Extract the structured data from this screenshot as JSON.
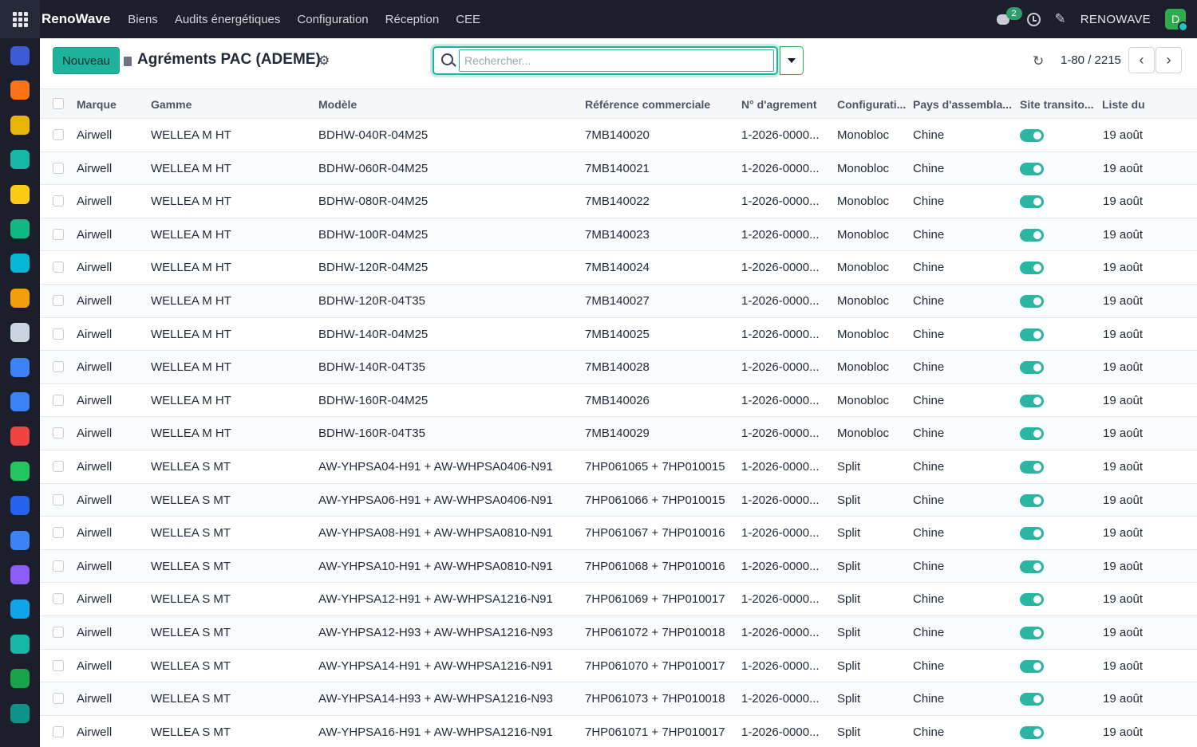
{
  "topbar": {
    "brand": "RenoWave",
    "menu": [
      "Biens",
      "Audits énergétiques",
      "Configuration",
      "Réception",
      "CEE"
    ],
    "chat_count": "2",
    "company": "RENOWAVE",
    "avatar_initial": "D"
  },
  "sidebar": {
    "icons": [
      {
        "name": "app-1-icon",
        "color": "#3b5bdb"
      },
      {
        "name": "app-2-icon",
        "color": "#f97316"
      },
      {
        "name": "calendar-31-icon",
        "color": "#eab308"
      },
      {
        "name": "sign-icon",
        "color": "#14b8a6"
      },
      {
        "name": "app-5-icon",
        "color": "#facc15"
      },
      {
        "name": "contacts-icon",
        "color": "#10b981"
      },
      {
        "name": "app-7-icon",
        "color": "#06b6d4"
      },
      {
        "name": "app-8-icon",
        "color": "#f59e0b"
      },
      {
        "name": "bank-icon",
        "color": "#cbd5e1"
      },
      {
        "name": "app-10-icon",
        "color": "#3b82f6"
      },
      {
        "name": "calendar-icon",
        "color": "#3b82f6"
      },
      {
        "name": "dashboard-icon",
        "color": "#ef4444"
      },
      {
        "name": "app-13-icon",
        "color": "#22c55e"
      },
      {
        "name": "calendar-2-icon",
        "color": "#2563eb"
      },
      {
        "name": "app-15-icon",
        "color": "#3b82f6"
      },
      {
        "name": "app-16-icon",
        "color": "#8b5cf6"
      },
      {
        "name": "app-17-icon",
        "color": "#0ea5e9"
      },
      {
        "name": "app-18-icon",
        "color": "#14b8a6"
      },
      {
        "name": "app-19-icon",
        "color": "#16a34a"
      },
      {
        "name": "app-20-icon",
        "color": "#0d9488"
      }
    ]
  },
  "control": {
    "new_button": "Nouveau",
    "title": "Agréments PAC (ADEME)",
    "search_placeholder": "Rechercher...",
    "pager": "1-80 / 2215"
  },
  "columns": [
    "Marque",
    "Gamme",
    "Modèle",
    "Référence commerciale",
    "N° d'agrement",
    "Configurati...",
    "Pays d'assembla...",
    "Site transito...",
    "Liste du"
  ],
  "rows": [
    {
      "marque": "Airwell",
      "gamme": "WELLEA M HT",
      "modele": "BDHW-040R-04M25",
      "ref": "7MB140020",
      "agrement": "1-2026-0000...",
      "config": "Monobloc",
      "pays": "Chine",
      "site": true,
      "liste": "19 août"
    },
    {
      "marque": "Airwell",
      "gamme": "WELLEA M HT",
      "modele": "BDHW-060R-04M25",
      "ref": "7MB140021",
      "agrement": "1-2026-0000...",
      "config": "Monobloc",
      "pays": "Chine",
      "site": true,
      "liste": "19 août"
    },
    {
      "marque": "Airwell",
      "gamme": "WELLEA M HT",
      "modele": "BDHW-080R-04M25",
      "ref": "7MB140022",
      "agrement": "1-2026-0000...",
      "config": "Monobloc",
      "pays": "Chine",
      "site": true,
      "liste": "19 août"
    },
    {
      "marque": "Airwell",
      "gamme": "WELLEA M HT",
      "modele": "BDHW-100R-04M25",
      "ref": "7MB140023",
      "agrement": "1-2026-0000...",
      "config": "Monobloc",
      "pays": "Chine",
      "site": true,
      "liste": "19 août"
    },
    {
      "marque": "Airwell",
      "gamme": "WELLEA M HT",
      "modele": "BDHW-120R-04M25",
      "ref": "7MB140024",
      "agrement": "1-2026-0000...",
      "config": "Monobloc",
      "pays": "Chine",
      "site": true,
      "liste": "19 août"
    },
    {
      "marque": "Airwell",
      "gamme": "WELLEA M HT",
      "modele": "BDHW-120R-04T35",
      "ref": "7MB140027",
      "agrement": "1-2026-0000...",
      "config": "Monobloc",
      "pays": "Chine",
      "site": true,
      "liste": "19 août"
    },
    {
      "marque": "Airwell",
      "gamme": "WELLEA M HT",
      "modele": "BDHW-140R-04M25",
      "ref": "7MB140025",
      "agrement": "1-2026-0000...",
      "config": "Monobloc",
      "pays": "Chine",
      "site": true,
      "liste": "19 août"
    },
    {
      "marque": "Airwell",
      "gamme": "WELLEA M HT",
      "modele": "BDHW-140R-04T35",
      "ref": "7MB140028",
      "agrement": "1-2026-0000...",
      "config": "Monobloc",
      "pays": "Chine",
      "site": true,
      "liste": "19 août"
    },
    {
      "marque": "Airwell",
      "gamme": "WELLEA M HT",
      "modele": "BDHW-160R-04M25",
      "ref": "7MB140026",
      "agrement": "1-2026-0000...",
      "config": "Monobloc",
      "pays": "Chine",
      "site": true,
      "liste": "19 août"
    },
    {
      "marque": "Airwell",
      "gamme": "WELLEA M HT",
      "modele": "BDHW-160R-04T35",
      "ref": "7MB140029",
      "agrement": "1-2026-0000...",
      "config": "Monobloc",
      "pays": "Chine",
      "site": true,
      "liste": "19 août"
    },
    {
      "marque": "Airwell",
      "gamme": "WELLEA S MT",
      "modele": "AW-YHPSA04-H91 + AW-WHPSA0406-N91",
      "ref": "7HP061065 + 7HP010015",
      "agrement": "1-2026-0000...",
      "config": "Split",
      "pays": "Chine",
      "site": true,
      "liste": "19 août"
    },
    {
      "marque": "Airwell",
      "gamme": "WELLEA S MT",
      "modele": "AW-YHPSA06-H91 + AW-WHPSA0406-N91",
      "ref": "7HP061066 + 7HP010015",
      "agrement": "1-2026-0000...",
      "config": "Split",
      "pays": "Chine",
      "site": true,
      "liste": "19 août"
    },
    {
      "marque": "Airwell",
      "gamme": "WELLEA S MT",
      "modele": "AW-YHPSA08-H91 + AW-WHPSA0810-N91",
      "ref": "7HP061067 + 7HP010016",
      "agrement": "1-2026-0000...",
      "config": "Split",
      "pays": "Chine",
      "site": true,
      "liste": "19 août"
    },
    {
      "marque": "Airwell",
      "gamme": "WELLEA S MT",
      "modele": "AW-YHPSA10-H91 + AW-WHPSA0810-N91",
      "ref": "7HP061068 + 7HP010016",
      "agrement": "1-2026-0000...",
      "config": "Split",
      "pays": "Chine",
      "site": true,
      "liste": "19 août"
    },
    {
      "marque": "Airwell",
      "gamme": "WELLEA S MT",
      "modele": "AW-YHPSA12-H91 + AW-WHPSA1216-N91",
      "ref": "7HP061069 + 7HP010017",
      "agrement": "1-2026-0000...",
      "config": "Split",
      "pays": "Chine",
      "site": true,
      "liste": "19 août"
    },
    {
      "marque": "Airwell",
      "gamme": "WELLEA S MT",
      "modele": "AW-YHPSA12-H93 + AW-WHPSA1216-N93",
      "ref": "7HP061072 + 7HP010018",
      "agrement": "1-2026-0000...",
      "config": "Split",
      "pays": "Chine",
      "site": true,
      "liste": "19 août"
    },
    {
      "marque": "Airwell",
      "gamme": "WELLEA S MT",
      "modele": "AW-YHPSA14-H91 + AW-WHPSA1216-N91",
      "ref": "7HP061070 + 7HP010017",
      "agrement": "1-2026-0000...",
      "config": "Split",
      "pays": "Chine",
      "site": true,
      "liste": "19 août"
    },
    {
      "marque": "Airwell",
      "gamme": "WELLEA S MT",
      "modele": "AW-YHPSA14-H93 + AW-WHPSA1216-N93",
      "ref": "7HP061073 + 7HP010018",
      "agrement": "1-2026-0000...",
      "config": "Split",
      "pays": "Chine",
      "site": true,
      "liste": "19 août"
    },
    {
      "marque": "Airwell",
      "gamme": "WELLEA S MT",
      "modele": "AW-YHPSA16-H91 + AW-WHPSA1216-N91",
      "ref": "7HP061071 + 7HP010017",
      "agrement": "1-2026-0000...",
      "config": "Split",
      "pays": "Chine",
      "site": true,
      "liste": "19 août"
    }
  ]
}
